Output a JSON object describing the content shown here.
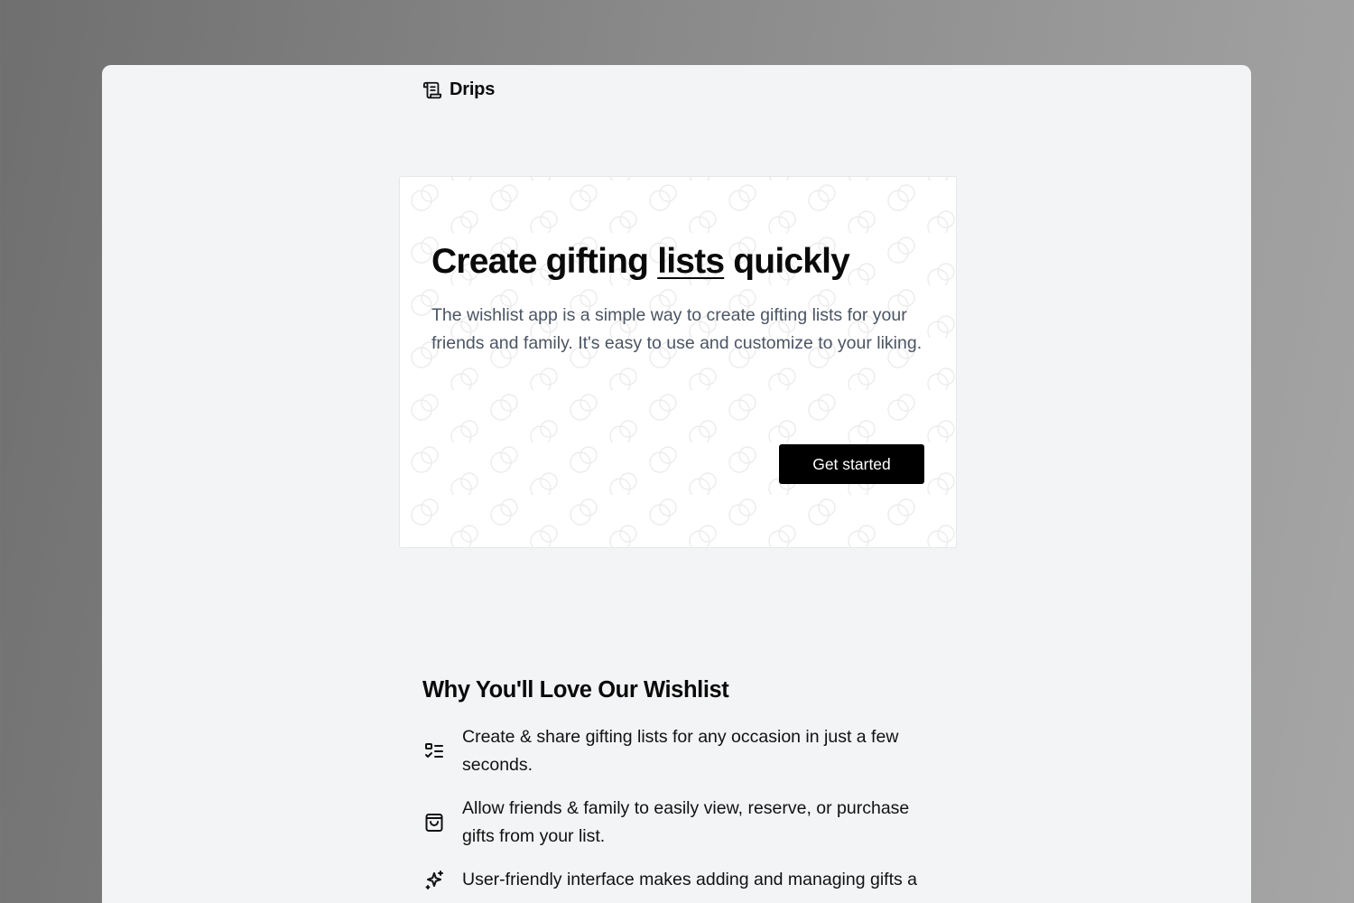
{
  "app": {
    "name": "Drips",
    "logo_icon": "scroll-icon"
  },
  "hero": {
    "title_before": "Create gifting ",
    "title_underlined": "lists",
    "title_after": " quickly",
    "description": "The wishlist app is a simple way to create gifting lists for your friends and family. It's easy to use and customize to your liking.",
    "cta_label": "Get started"
  },
  "why": {
    "title": "Why You'll Love Our Wishlist",
    "features": [
      {
        "icon": "list-check-icon",
        "text": "Create & share gifting lists for any occasion in just a few seconds."
      },
      {
        "icon": "shopping-bag-icon",
        "text": "Allow friends & family to easily view, reserve, or purchase gifts from your list."
      },
      {
        "icon": "sparkles-icon",
        "text": "User-friendly interface makes adding and managing gifts a"
      }
    ]
  },
  "colors": {
    "page_background": "#f3f4f6",
    "card_background": "#ffffff",
    "primary_button": "#000000",
    "description_text": "#4b5563"
  }
}
